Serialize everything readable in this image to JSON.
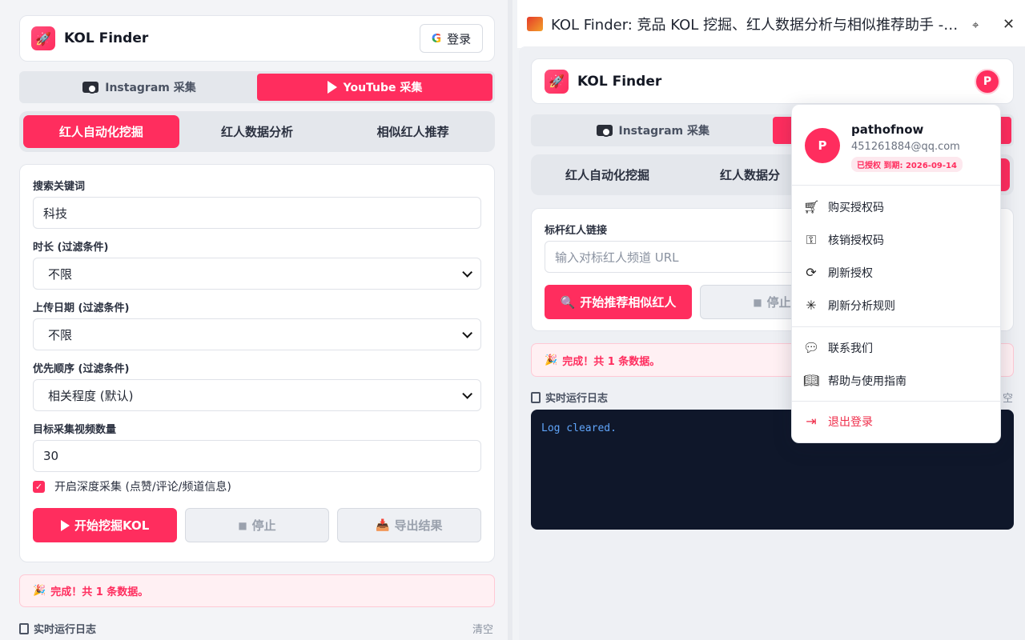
{
  "left": {
    "app_name": "KOL Finder",
    "login_label": "登录",
    "platform_tabs": [
      {
        "label": "Instagram 采集"
      },
      {
        "label": "YouTube 采集"
      }
    ],
    "feature_tabs": [
      {
        "label": "红人自动化挖掘"
      },
      {
        "label": "红人数据分析"
      },
      {
        "label": "相似红人推荐"
      }
    ],
    "form": {
      "keyword_label": "搜索关键词",
      "keyword_value": "科技",
      "duration_label": "时长 (过滤条件)",
      "duration_value": "不限",
      "upload_label": "上传日期 (过滤条件)",
      "upload_value": "不限",
      "priority_label": "优先顺序 (过滤条件)",
      "priority_value": "相关程度 (默认)",
      "count_label": "目标采集视频数量",
      "count_value": "30",
      "deep_label": "开启深度采集 (点赞/评论/频道信息)",
      "start_label": "开始挖掘KOL",
      "stop_label": "停止",
      "export_label": "导出结果"
    },
    "status_text": "完成！共 1 条数据。",
    "log_title": "实时运行日志",
    "clear_label": "清空"
  },
  "right": {
    "window_title": "KOL Finder: 竞品 KOL 挖掘、红人数据分析与相似推荐助手 - pa...",
    "app_name": "KOL Finder",
    "avatar_letter": "P",
    "platform_tabs": [
      {
        "label": "Instagram 采集"
      }
    ],
    "feature_tabs": [
      {
        "label": "红人自动化挖掘"
      },
      {
        "label": "红人数据分"
      }
    ],
    "form": {
      "link_label": "标杆红人链接",
      "link_placeholder": "输入对标红人频道 URL",
      "start_label": "开始推荐相似红人",
      "stop_label": "停止"
    },
    "status_text": "完成！共 1 条数据。",
    "log_title": "实时运行日志",
    "log_text": "Log cleared.",
    "clear_label_partial": "空"
  },
  "menu": {
    "username": "pathofnow",
    "email": "451261884@qq.com",
    "badge": "已授权 到期: 2026-09-14",
    "avatar_letter": "P",
    "items": [
      {
        "label": "购买授权码",
        "icon": "cart-icon"
      },
      {
        "label": "核销授权码",
        "icon": "key-icon"
      },
      {
        "label": "刷新授权",
        "icon": "refresh-icon"
      },
      {
        "label": "刷新分析规则",
        "icon": "loader-icon"
      }
    ],
    "items2": [
      {
        "label": "联系我们",
        "icon": "chat-icon"
      },
      {
        "label": "帮助与使用指南",
        "icon": "book-icon"
      }
    ],
    "logout": {
      "label": "退出登录",
      "icon": "logout-icon"
    }
  },
  "colors": {
    "accent": "#ff2d5e",
    "log_bg": "#0f172a",
    "log_text": "#60a5fa"
  }
}
